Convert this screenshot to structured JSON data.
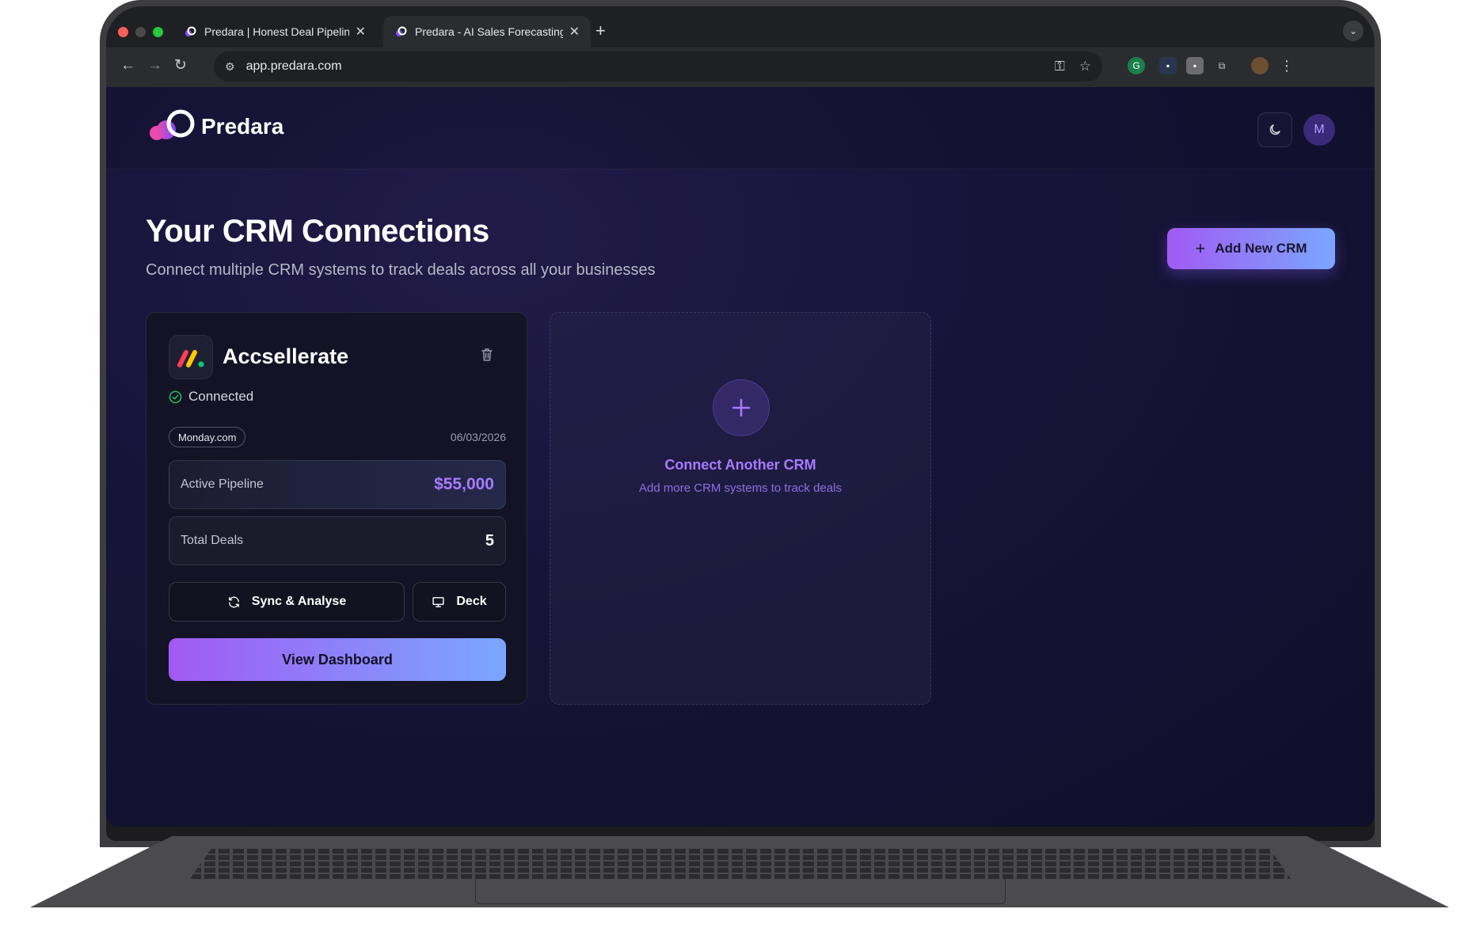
{
  "browser": {
    "tabs": [
      {
        "title": "Predara | Honest Deal Pipeline",
        "active": false
      },
      {
        "title": "Predara - AI Sales Forecasting",
        "active": true
      }
    ],
    "url": "app.predara.com"
  },
  "app": {
    "brand": "Predara",
    "avatar_initial": "M",
    "page_title": "Your CRM Connections",
    "page_subtitle": "Connect multiple CRM systems to track deals across all your businesses",
    "add_crm_label": "Add New CRM"
  },
  "crm_card": {
    "name": "Accsellerate",
    "status": "Connected",
    "source": "Monday.com",
    "date": "06/03/2026",
    "metrics": [
      {
        "label": "Active Pipeline",
        "value": "$55,000"
      },
      {
        "label": "Total Deals",
        "value": "5"
      }
    ],
    "sync_label": "Sync & Analyse",
    "deck_label": "Deck",
    "dashboard_label": "View Dashboard"
  },
  "connect_card": {
    "title": "Connect Another CRM",
    "subtitle": "Add more CRM systems to track deals"
  },
  "colors": {
    "accent_purple": "#a77bff",
    "button_gradient_start": "#a15af3",
    "button_gradient_end": "#7aa7ff",
    "connected_green": "#22c55e"
  }
}
